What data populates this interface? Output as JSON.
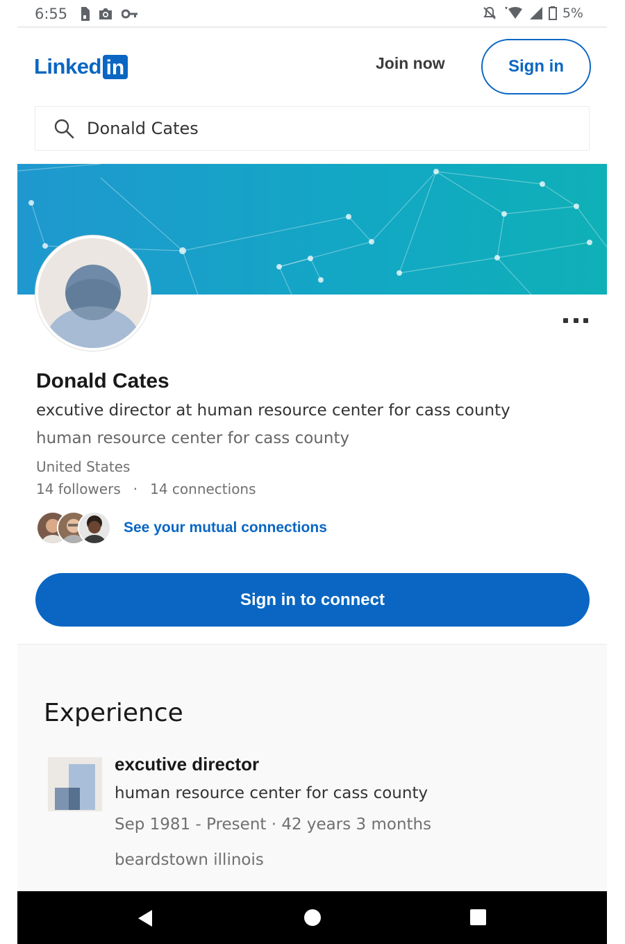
{
  "status_bar": {
    "time": "6:55",
    "battery": "5%",
    "icons": [
      "sim-icon",
      "camera-icon",
      "key-icon",
      "mute-icon",
      "wifi-icon",
      "signal-icon",
      "battery-icon"
    ]
  },
  "header": {
    "logo_text": "Linked",
    "logo_box": "in",
    "join_label": "Join now",
    "signin_label": "Sign in"
  },
  "search": {
    "value": "Donald Cates"
  },
  "profile": {
    "name": "Donald Cates",
    "headline": "excutive director at human resource center for cass county",
    "company": "human resource center for cass county",
    "location": "United States",
    "followers": "14 followers",
    "separator": "·",
    "connections": "14 connections",
    "mutual_label": "See your mutual connections",
    "connect_label": "Sign in to connect"
  },
  "experience": {
    "heading": "Experience",
    "items": [
      {
        "title": "excutive director",
        "company": "human resource center for cass county",
        "dates": "Sep 1981 - Present  · 42 years 3 months",
        "location": "beardstown illinois"
      }
    ]
  },
  "colors": {
    "brand": "#0a66c2",
    "banner_start": "#1f98cf",
    "banner_end": "#0fb0b7"
  }
}
